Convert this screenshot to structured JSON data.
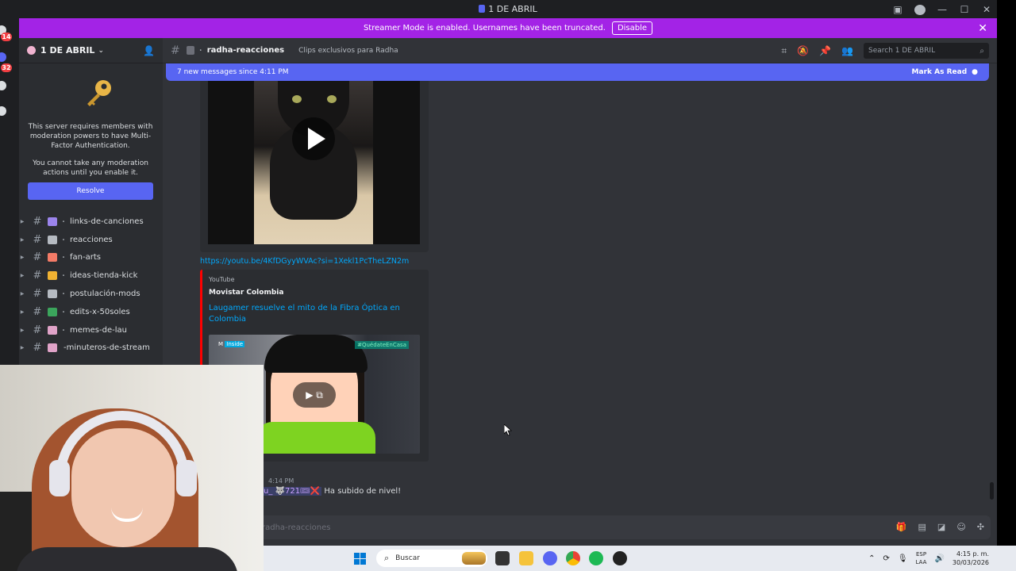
{
  "window": {
    "title": "1 DE ABRIL"
  },
  "rail": {
    "badge1": "14",
    "badge2": "32"
  },
  "banner": {
    "text": "Streamer Mode is enabled. Usernames have been truncated.",
    "disable_label": "Disable"
  },
  "server": {
    "name": "1 DE ABRIL"
  },
  "mfa": {
    "line1": "This server requires members with moderation powers to have Multi-Factor Authentication.",
    "line2": "You cannot take any moderation actions until you enable it.",
    "resolve_label": "Resolve"
  },
  "channels": [
    {
      "name": "links-de-canciones",
      "emoji_color": "#9b84ec",
      "sep": "・"
    },
    {
      "name": "reacciones",
      "emoji_color": "#b5bac1",
      "sep": "・"
    },
    {
      "name": "fan-arts",
      "emoji_color": "#f47b67",
      "sep": "・"
    },
    {
      "name": "ideas-tienda-kick",
      "emoji_color": "#f0b232",
      "sep": "・"
    },
    {
      "name": "postulación-mods",
      "emoji_color": "#b5bac1",
      "sep": "・"
    },
    {
      "name": "edits-x-50soles",
      "emoji_color": "#3ba55c",
      "sep": "・"
    },
    {
      "name": "memes-de-lau",
      "emoji_color": "#e0a3c8",
      "sep": "・"
    },
    {
      "name": "-minuteros-de-stream",
      "emoji_color": "#e0a3c8",
      "sep": ""
    }
  ],
  "channel_header": {
    "name": "radha-reacciones",
    "topic": "Clips exclusivos para Radha",
    "search_placeholder": "Search 1 DE ABRIL"
  },
  "new_messages": {
    "text": "7 new messages since 4:11 PM",
    "mark_label": "Mark As Read"
  },
  "messages": {
    "link": "https://youtu.be/4KfDGyyWVAc?si=1Xekl1PcTheLZN2m",
    "embed": {
      "provider": "YouTube",
      "author": "Movistar Colombia",
      "title": "Laugamer resuelve el mito de la Fibra Óptica en Colombia",
      "thumb_logo": "Inside",
      "thumb_tag": "#QuédateEnCasa"
    },
    "last_time": "4:14 PM",
    "last_nick": "u_ 🐺721🎟❌",
    "last_text": "Ha subido de nivel!"
  },
  "composer": {
    "placeholder": "radha-reacciones"
  },
  "taskbar": {
    "search_label": "Buscar",
    "lang_line1": "ESP",
    "lang_line2": "LAA",
    "time": "4:15 p. m.",
    "date": "30/03/2026"
  },
  "colors": {
    "banner": "#a323e6",
    "accent": "#5865f2",
    "link": "#00a8fc",
    "youtube": "#ff0000"
  }
}
